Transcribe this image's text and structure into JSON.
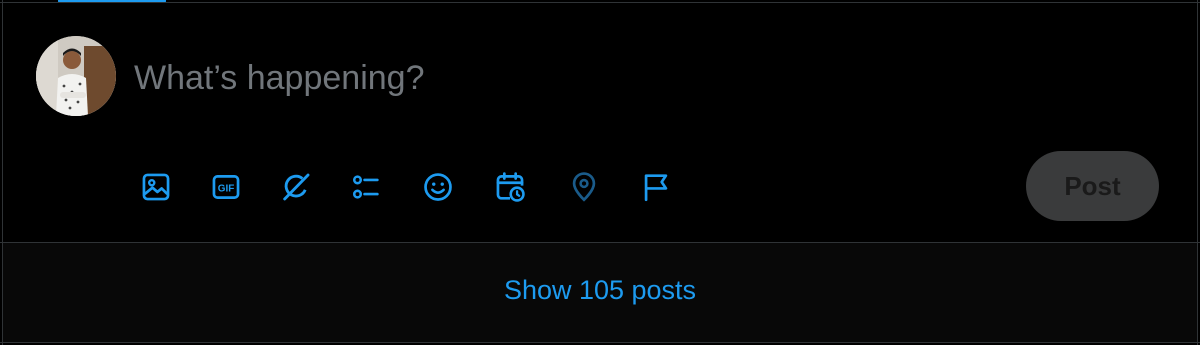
{
  "composer": {
    "placeholder": "What’s happening?",
    "post_label": "Post",
    "toolbar": [
      {
        "name": "media-icon",
        "label": "Media"
      },
      {
        "name": "gif-icon",
        "label": "GIF"
      },
      {
        "name": "grok-icon",
        "label": "Grok"
      },
      {
        "name": "poll-icon",
        "label": "Poll"
      },
      {
        "name": "emoji-icon",
        "label": "Emoji"
      },
      {
        "name": "schedule-icon",
        "label": "Schedule"
      },
      {
        "name": "location-icon",
        "label": "Tag Location"
      },
      {
        "name": "flag-icon",
        "label": "Flag"
      }
    ]
  },
  "feed": {
    "show_posts_label": "Show 105 posts"
  },
  "colors": {
    "accent": "#1d9bf0",
    "border": "#2f3336",
    "placeholder": "#71767b",
    "post_disabled_bg": "#3a3b3c"
  }
}
